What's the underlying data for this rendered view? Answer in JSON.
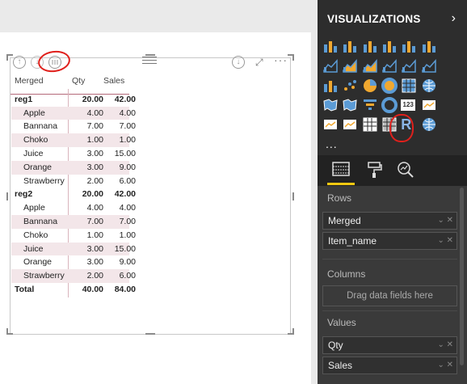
{
  "panel": {
    "title": "VISUALIZATIONS",
    "chevron": "›",
    "more": "...",
    "tabs": [
      "fields-icon",
      "format-roller-icon",
      "analytics-magnifier-icon"
    ],
    "sections": {
      "rows_label": "Rows",
      "rows_fields": [
        "Merged",
        "Item_name"
      ],
      "columns_label": "Columns",
      "columns_placeholder": "Drag data fields here",
      "values_label": "Values",
      "values_fields": [
        "Qty",
        "Sales"
      ]
    },
    "well_controls": "⌄ ✕",
    "accent_color": "#f2c811"
  },
  "visual_header": {
    "drill_up_icon": "↑",
    "drill_mode_icon": "↓",
    "drill_down_icon": "↓",
    "focus_icon": "⤢",
    "more_icon": "···"
  },
  "matrix": {
    "headers": [
      "Merged",
      "Qty",
      "Sales"
    ],
    "rows": [
      {
        "name": "reg1",
        "qty": "20.00",
        "sales": "42.00",
        "level": 0,
        "bold": true
      },
      {
        "name": "Apple",
        "qty": "4.00",
        "sales": "4.00",
        "level": 1
      },
      {
        "name": "Bannana",
        "qty": "7.00",
        "sales": "7.00",
        "level": 1
      },
      {
        "name": "Choko",
        "qty": "1.00",
        "sales": "1.00",
        "level": 1
      },
      {
        "name": "Juice",
        "qty": "3.00",
        "sales": "15.00",
        "level": 1
      },
      {
        "name": "Orange",
        "qty": "3.00",
        "sales": "9.00",
        "level": 1
      },
      {
        "name": "Strawberry",
        "qty": "2.00",
        "sales": "6.00",
        "level": 1
      },
      {
        "name": "reg2",
        "qty": "20.00",
        "sales": "42.00",
        "level": 0,
        "bold": true
      },
      {
        "name": "Apple",
        "qty": "4.00",
        "sales": "4.00",
        "level": 1
      },
      {
        "name": "Bannana",
        "qty": "7.00",
        "sales": "7.00",
        "level": 1
      },
      {
        "name": "Choko",
        "qty": "1.00",
        "sales": "1.00",
        "level": 1
      },
      {
        "name": "Juice",
        "qty": "3.00",
        "sales": "15.00",
        "level": 1
      },
      {
        "name": "Orange",
        "qty": "3.00",
        "sales": "9.00",
        "level": 1
      },
      {
        "name": "Strawberry",
        "qty": "2.00",
        "sales": "6.00",
        "level": 1
      },
      {
        "name": "Total",
        "qty": "40.00",
        "sales": "84.00",
        "level": 0,
        "bold": true
      }
    ]
  },
  "gallery_icons": [
    "stacked-bar-chart-icon",
    "stacked-column-chart-icon",
    "clustered-bar-chart-icon",
    "clustered-column-chart-icon",
    "100-stacked-bar-chart-icon",
    "100-stacked-column-chart-icon",
    "line-chart-icon",
    "area-chart-icon",
    "stacked-area-chart-icon",
    "line-and-column-chart-icon",
    "line-and-clustered-column-chart-icon",
    "ribbon-chart-icon",
    "waterfall-chart-icon",
    "scatter-chart-icon",
    "pie-chart-icon",
    "donut-chart-icon",
    "treemap-icon",
    "map-icon",
    "filled-map-icon",
    "shape-map-icon",
    "funnel-icon",
    "gauge-icon",
    "card-icon",
    "multi-row-card-icon",
    "kpi-icon",
    "slicer-icon",
    "table-icon",
    "matrix-icon",
    "r-script-visual-icon",
    "globe-icon"
  ],
  "gallery_card_text": "123",
  "gallery_r_text": "R"
}
